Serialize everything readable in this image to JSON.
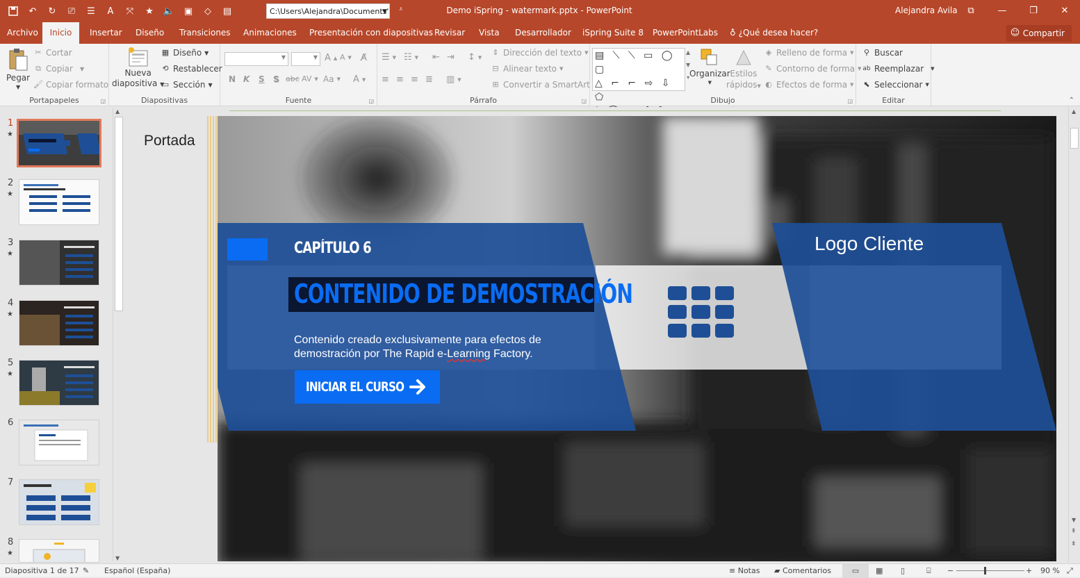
{
  "window": {
    "title": "Demo iSpring - watermark.pptx - PowerPoint",
    "path": "C:\\Users\\Alejandra\\Documents'",
    "user": "Alejandra Avila"
  },
  "tabs": [
    {
      "label": "Archivo"
    },
    {
      "label": "Inicio"
    },
    {
      "label": "Insertar"
    },
    {
      "label": "Diseño"
    },
    {
      "label": "Transiciones"
    },
    {
      "label": "Animaciones"
    },
    {
      "label": "Presentación con diapositivas"
    },
    {
      "label": "Revisar"
    },
    {
      "label": "Vista"
    },
    {
      "label": "Desarrollador"
    },
    {
      "label": "iSpring Suite 8"
    },
    {
      "label": "PowerPointLabs"
    }
  ],
  "tell_me": "¿Qué desea hacer?",
  "share": "Compartir",
  "ribbon": {
    "portapapeles": {
      "label": "Portapapeles",
      "paste": "Pegar",
      "cut": "Cortar",
      "copy": "Copiar",
      "format_painter": "Copiar formato"
    },
    "diapositivas": {
      "label": "Diapositivas",
      "new_slide_1": "Nueva",
      "new_slide_2": "diapositiva",
      "layout": "Diseño",
      "reset": "Restablecer",
      "section": "Sección"
    },
    "fuente": {
      "label": "Fuente",
      "bold": "N",
      "italic": "K",
      "underline": "S",
      "shadow": "S",
      "strike": "abc",
      "spacing": "AV",
      "case": "Aa",
      "color": "A"
    },
    "parrafo": {
      "label": "Párrafo",
      "direction": "Dirección del texto",
      "align": "Alinear texto",
      "smartart": "Convertir a SmartArt"
    },
    "dibujo": {
      "label": "Dibujo",
      "arrange": "Organizar",
      "quick_styles_1": "Estilos",
      "quick_styles_2": "rápidos",
      "fill": "Relleno de forma",
      "outline": "Contorno de forma",
      "effects": "Efectos de forma"
    },
    "editar": {
      "label": "Editar",
      "find": "Buscar",
      "replace": "Reemplazar",
      "select": "Seleccionar"
    }
  },
  "thumbnails": [
    {
      "num": "1",
      "selected": true
    },
    {
      "num": "2"
    },
    {
      "num": "3"
    },
    {
      "num": "4"
    },
    {
      "num": "5"
    },
    {
      "num": "6"
    },
    {
      "num": "7"
    },
    {
      "num": "8"
    }
  ],
  "section_title": "Portada",
  "slide": {
    "chapter": "CAPÍTULO 6",
    "title": "CONTENIDO DE DEMOSTRACIÓN",
    "body_line1": "Contenido creado exclusivamente para efectos de",
    "body_line2_a": "demostración por The Rapid e-",
    "body_line2_b": "Learning",
    "body_line2_c": " Factory.",
    "button": "INICIAR EL CURSO",
    "logo": "Logo Cliente",
    "colors": {
      "accent": "#0a6cf2",
      "panel": "#1e4f96",
      "title_bg": "#0b1630"
    }
  },
  "status": {
    "slide_count": "Diapositiva 1 de 17",
    "language": "Español (España)",
    "notes": "Notas",
    "comments": "Comentarios",
    "zoom": "90 %"
  }
}
